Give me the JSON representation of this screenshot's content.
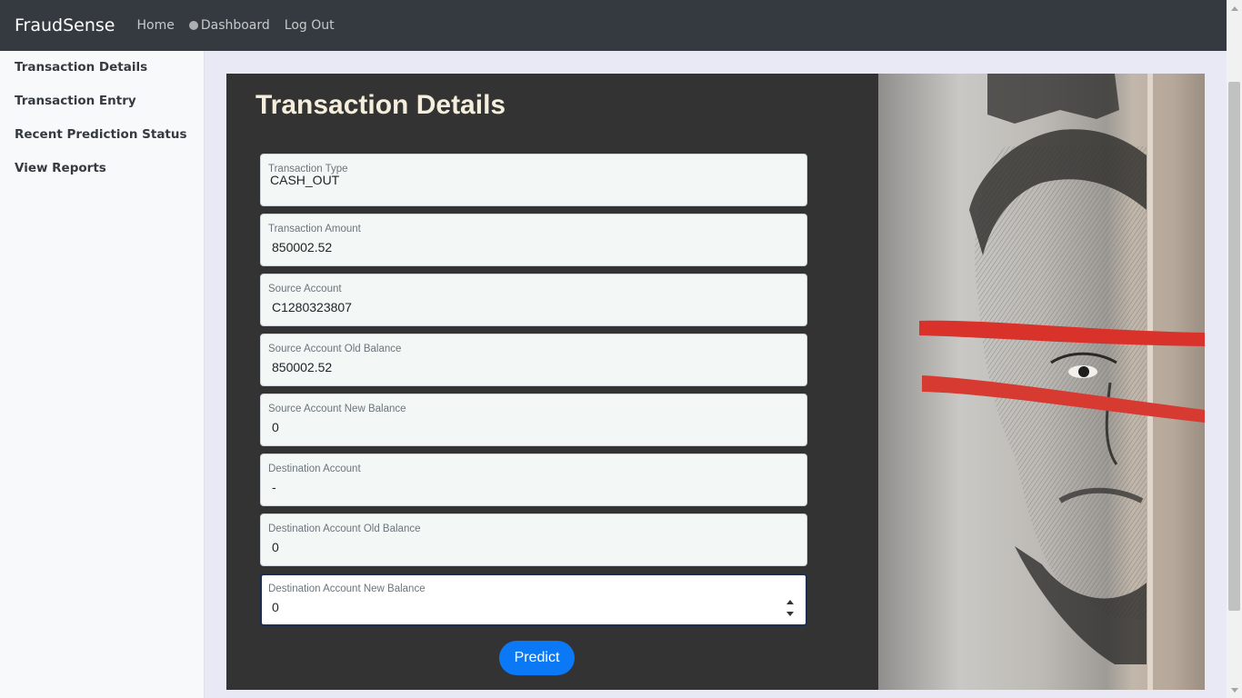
{
  "navbar": {
    "brand": "FraudSense",
    "links": [
      "Home",
      "Dashboard",
      "Log Out"
    ]
  },
  "sidebar": {
    "items": [
      {
        "label": "Transaction Details"
      },
      {
        "label": "Transaction Entry"
      },
      {
        "label": "Recent Prediction Status"
      },
      {
        "label": "View Reports"
      }
    ]
  },
  "form": {
    "title": "Transaction Details",
    "fields": [
      {
        "label": "Transaction Type",
        "value": "CASH_OUT"
      },
      {
        "label": "Transaction Amount",
        "value": "850002.52"
      },
      {
        "label": "Source Account",
        "value": "C1280323807"
      },
      {
        "label": "Source Account Old Balance",
        "value": "850002.52"
      },
      {
        "label": "Source Account New Balance",
        "value": "0"
      },
      {
        "label": "Destination Account",
        "value": "-"
      },
      {
        "label": "Destination Account Old Balance",
        "value": "0"
      },
      {
        "label": "Destination Account New Balance",
        "value": "0"
      }
    ],
    "submit_label": "Predict"
  },
  "colors": {
    "navbar": "#343a40",
    "card": "#333333",
    "title": "#f5eedc",
    "button": "#0b79f5",
    "page_bg": "#e8e9f4"
  }
}
